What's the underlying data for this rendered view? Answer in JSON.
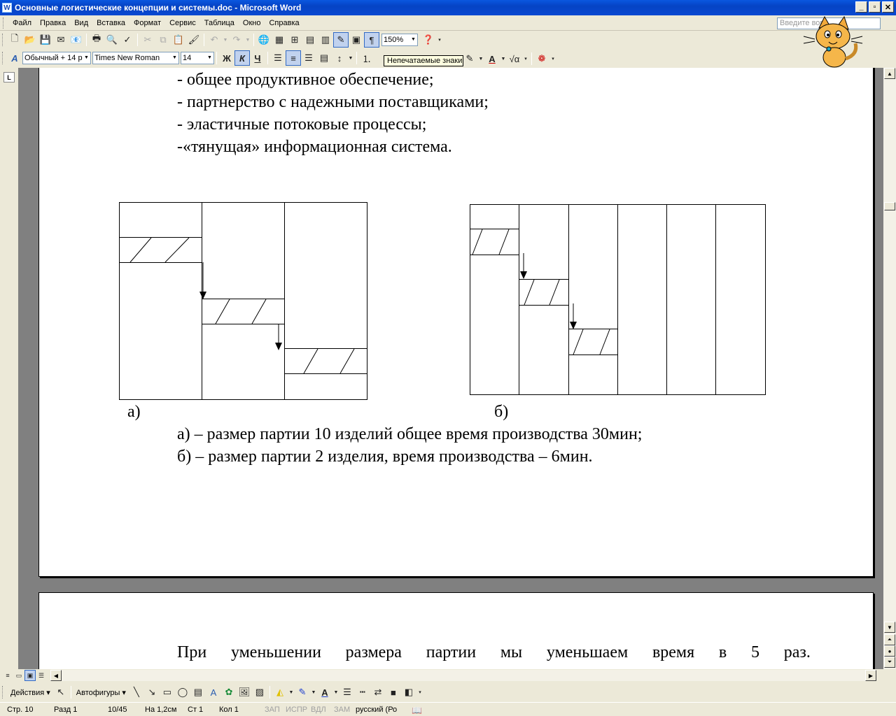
{
  "window": {
    "title": "Основные логистические концепции и системы.doc - Microsoft Word",
    "app_icon": "W"
  },
  "menu": {
    "items": [
      "Файл",
      "Правка",
      "Вид",
      "Вставка",
      "Формат",
      "Сервис",
      "Таблица",
      "Окно",
      "Справка"
    ],
    "ask_placeholder": "Введите вопр"
  },
  "toolbar": {
    "zoom": "150%",
    "style": "Обычный + 14 p",
    "font": "Times New Roman",
    "size": "14",
    "bold": "Ж",
    "italic": "К",
    "underline": "Ч",
    "pilcrow": "¶",
    "tooltip": "Непечатаемые знаки"
  },
  "ruler": {
    "tab_marker": "L"
  },
  "document": {
    "bullets": [
      "- общее продуктивное обеспечение;",
      "- партнерство с надежными поставщиками;",
      "- эластичные потоковые процессы;",
      "-«тянущая» информационная система."
    ],
    "label_a": "а)",
    "label_b": "б)",
    "caption_a": "а) – размер партии 10 изделий общее время производства 30мин;",
    "caption_b": "б) – размер партии 2 изделия, время производства – 6мин.",
    "page2_line": [
      "При",
      "уменьшении",
      "размера",
      "партии",
      "мы",
      "уменьшаем",
      "время",
      "в",
      "5",
      "раз."
    ]
  },
  "drawbar": {
    "actions": "Действия",
    "autoshapes": "Автофигуры"
  },
  "status": {
    "page": "Стр. 10",
    "section": "Разд 1",
    "pages": "10/45",
    "at": "На 1,2см",
    "line": "Ст 1",
    "col": "Кол 1",
    "rec": "ЗАП",
    "trk": "ИСПР",
    "ext": "ВДЛ",
    "ovr": "ЗАМ",
    "lang": "русский (Ро"
  }
}
